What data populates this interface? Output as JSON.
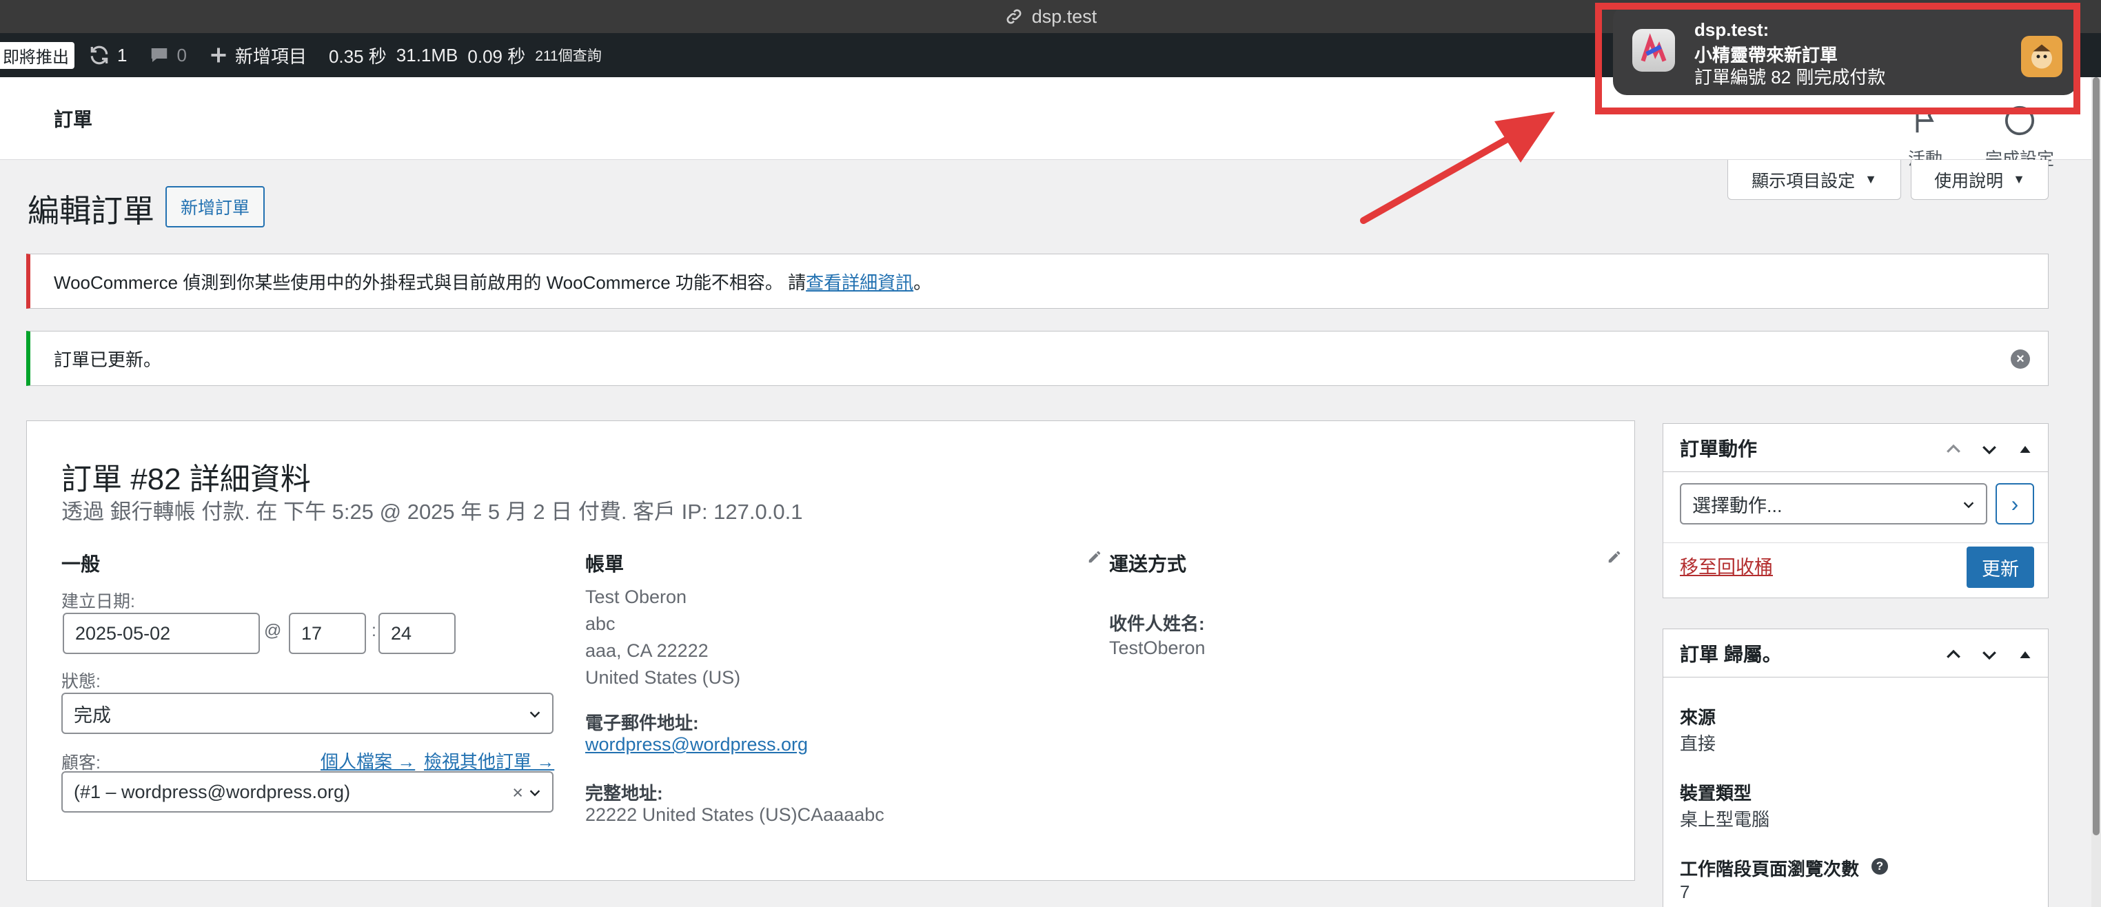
{
  "browser": {
    "url": "dsp.test"
  },
  "adminbar": {
    "badge": "即將推出",
    "updates_count": "1",
    "comments_count": "0",
    "new_item": "新增項目",
    "stat1": "0.35 秒",
    "stat2": "31.1MB",
    "stat3": "0.09 秒",
    "stat4": "211個查詢"
  },
  "wc_header": {
    "title": "訂單",
    "activity_label": "活動",
    "setup_label": "完成設定"
  },
  "screen_options": {
    "display_settings": "顯示項目設定",
    "help": "使用說明"
  },
  "page": {
    "title": "編輯訂單",
    "add_order": "新增訂單"
  },
  "notices": {
    "incompat_text": "WooCommerce 偵測到你某些使用中的外掛程式與目前啟用的 WooCommerce 功能不相容。 請",
    "incompat_link": "查看詳細資訊",
    "incompat_end": "。",
    "updated": "訂單已更新。"
  },
  "order": {
    "heading": "訂單 #82 詳細資料",
    "subheading": "透過 銀行轉帳 付款. 在 下午 5:25 @ 2025 年 5 月 2 日 付費. 客戶 IP: 127.0.0.1",
    "general": {
      "title": "一般",
      "created_label": "建立日期:",
      "date": "2025-05-02",
      "at": "@",
      "hour": "17",
      "colon": ":",
      "minute": "24",
      "status_label": "狀態:",
      "status_value": "完成",
      "customer_label": "顧客:",
      "profile_link": "個人檔案 →",
      "other_orders_link": "檢視其他訂單 →",
      "customer_value": "(#1 – wordpress@wordpress.org)",
      "clear": "×"
    },
    "billing": {
      "title": "帳單",
      "lines": [
        "Test Oberon",
        "abc",
        "aaa, CA 22222",
        "United States (US)"
      ],
      "email_label": "電子郵件地址:",
      "email": "wordpress@wordpress.org",
      "address_label": "完整地址:",
      "address": "22222 United States (US)CAaaaabc"
    },
    "shipping": {
      "title": "運送方式",
      "recipient_label": "收件人姓名:",
      "recipient": "TestOberon"
    }
  },
  "order_actions": {
    "title": "訂單動作",
    "select_value": "選擇動作...",
    "go": "›",
    "trash": "移至回收桶",
    "update": "更新"
  },
  "attribution": {
    "title": "訂單 歸屬。",
    "source_label": "來源",
    "source_value": "直接",
    "device_label": "裝置類型",
    "device_value": "桌上型電腦",
    "pageviews_label": "工作階段頁面瀏覽次數",
    "pageviews_value": "7",
    "help": "?"
  },
  "notification": {
    "app": "dsp.test:",
    "title": "小精靈帶來新訂單",
    "body": "訂單編號 82 剛完成付款"
  },
  "colors": {
    "highlight": "#e33a3a",
    "wp_blue": "#2271b1",
    "admin_bar": "#1d2327"
  }
}
